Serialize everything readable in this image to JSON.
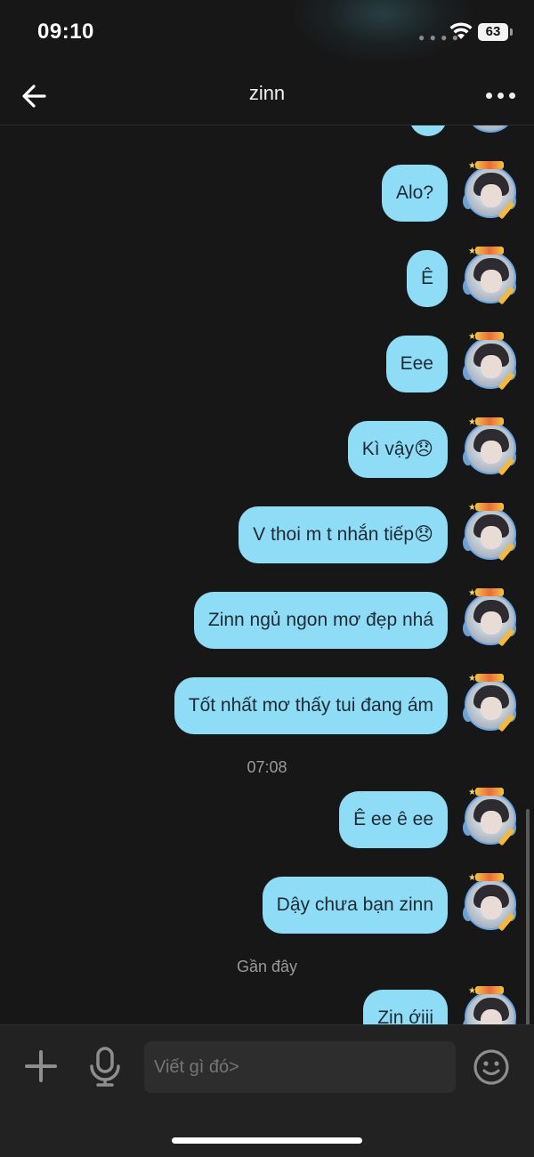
{
  "status_bar": {
    "time": "09:10",
    "battery": "63"
  },
  "header": {
    "title": "zinn"
  },
  "messages": [
    {
      "text": "Alo?"
    },
    {
      "text": "Ê"
    },
    {
      "text": "Eee"
    },
    {
      "text": "Kì vậy😞"
    },
    {
      "text": "V thoi m t nhắn tiếp😞"
    },
    {
      "text": "Zinn ngủ ngon mơ đẹp nhá"
    },
    {
      "text": "Tốt nhất mơ thấy tui đang ám"
    },
    {
      "text": "Ê ee ê ee"
    },
    {
      "text": "Dậy chưa bạn zinn"
    },
    {
      "text": "Zin ớiii"
    }
  ],
  "timestamps": {
    "first": "07:08",
    "second": "Gần đây"
  },
  "composer": {
    "placeholder": "Viết gì đó>"
  },
  "colors": {
    "bubble": "#8fdcf7",
    "background": "#171717"
  }
}
